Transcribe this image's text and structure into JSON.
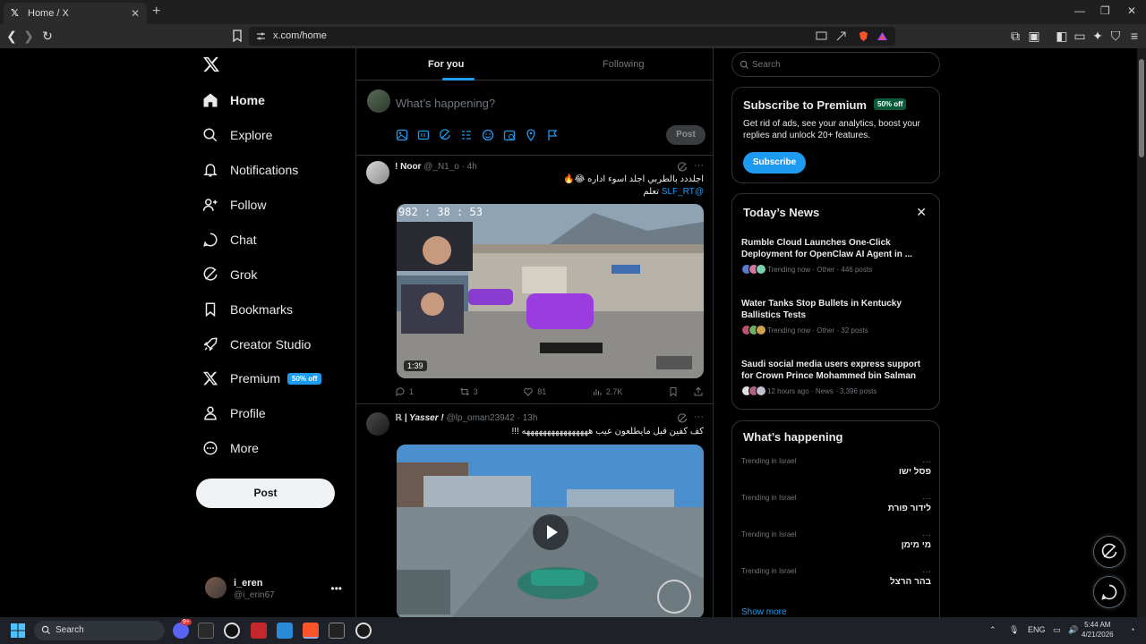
{
  "browser": {
    "tab_title": "Home / X",
    "url": "x.com/home"
  },
  "nav": {
    "items": [
      {
        "label": "Home",
        "icon": "home-icon"
      },
      {
        "label": "Explore",
        "icon": "search-icon"
      },
      {
        "label": "Notifications",
        "icon": "bell-icon"
      },
      {
        "label": "Follow",
        "icon": "person-plus-icon"
      },
      {
        "label": "Chat",
        "icon": "chat-icon"
      },
      {
        "label": "Grok",
        "icon": "grok-icon"
      },
      {
        "label": "Bookmarks",
        "icon": "bookmark-icon"
      },
      {
        "label": "Creator Studio",
        "icon": "rocket-icon"
      },
      {
        "label": "Premium",
        "icon": "x-icon"
      },
      {
        "label": "Profile",
        "icon": "person-icon"
      },
      {
        "label": "More",
        "icon": "more-circle-icon"
      }
    ],
    "premium_badge": "50% off",
    "post_button": "Post",
    "account": {
      "name": "i_eren",
      "handle": "@i_erin67"
    }
  },
  "timeline": {
    "tabs": [
      "For you",
      "Following"
    ],
    "composer_placeholder": "What’s happening?",
    "composer_post": "Post",
    "tweets": [
      {
        "name": "! Noor",
        "handle": "@_N1_o",
        "time": "4h",
        "line1": "اجلددد بالطربي اجلد اسوء اداره 😂🔥",
        "line2_link": "@SLF_RT",
        "line2_text": "تعلم",
        "video_timer": "982 : 38 : 53",
        "duration": "1:39",
        "replies": "1",
        "reposts": "3",
        "likes": "81",
        "views": "2.7K"
      },
      {
        "name": "ℝ | Yasser !",
        "handle": "@lp_oman23942",
        "time": "13h",
        "line1": "كف كفين قبل مايطلعون  عيب ههههههههههههههههه !!!"
      }
    ]
  },
  "right": {
    "search_placeholder": "Search",
    "premium": {
      "title": "Subscribe to Premium",
      "badge": "50% off",
      "text": "Get rid of ads, see your analytics, boost your replies and unlock 20+ features.",
      "button": "Subscribe"
    },
    "news": {
      "title": "Today’s News",
      "items": [
        {
          "title": "Rumble Cloud Launches One-Click Deployment for OpenClaw AI Agent in ...",
          "meta": "Trending now · Other · 446 posts"
        },
        {
          "title": "Water Tanks Stop Bullets in Kentucky Ballistics Tests",
          "meta": "Trending now · Other · 32 posts"
        },
        {
          "title": "Saudi social media users express support for Crown Prince Mohammed bin Salman",
          "meta": "12 hours ago · News · 3,396 posts"
        }
      ]
    },
    "happening": {
      "title": "What’s happening",
      "trends": [
        {
          "context": "Trending in Israel",
          "name": "פסל ישו"
        },
        {
          "context": "Trending in Israel",
          "name": "לידור פורת"
        },
        {
          "context": "Trending in Israel",
          "name": "מי מימן"
        },
        {
          "context": "Trending in Israel",
          "name": "בהר הרצל"
        }
      ],
      "show_more": "Show more"
    }
  },
  "taskbar": {
    "search_placeholder": "Search",
    "lang": "ENG",
    "time": "5:44 AM",
    "date": "4/21/2026",
    "discord_badge": "9+"
  },
  "colors": {
    "accent": "#1d9bf0",
    "background": "#000000",
    "border": "#2f3336",
    "muted": "#71767b"
  }
}
